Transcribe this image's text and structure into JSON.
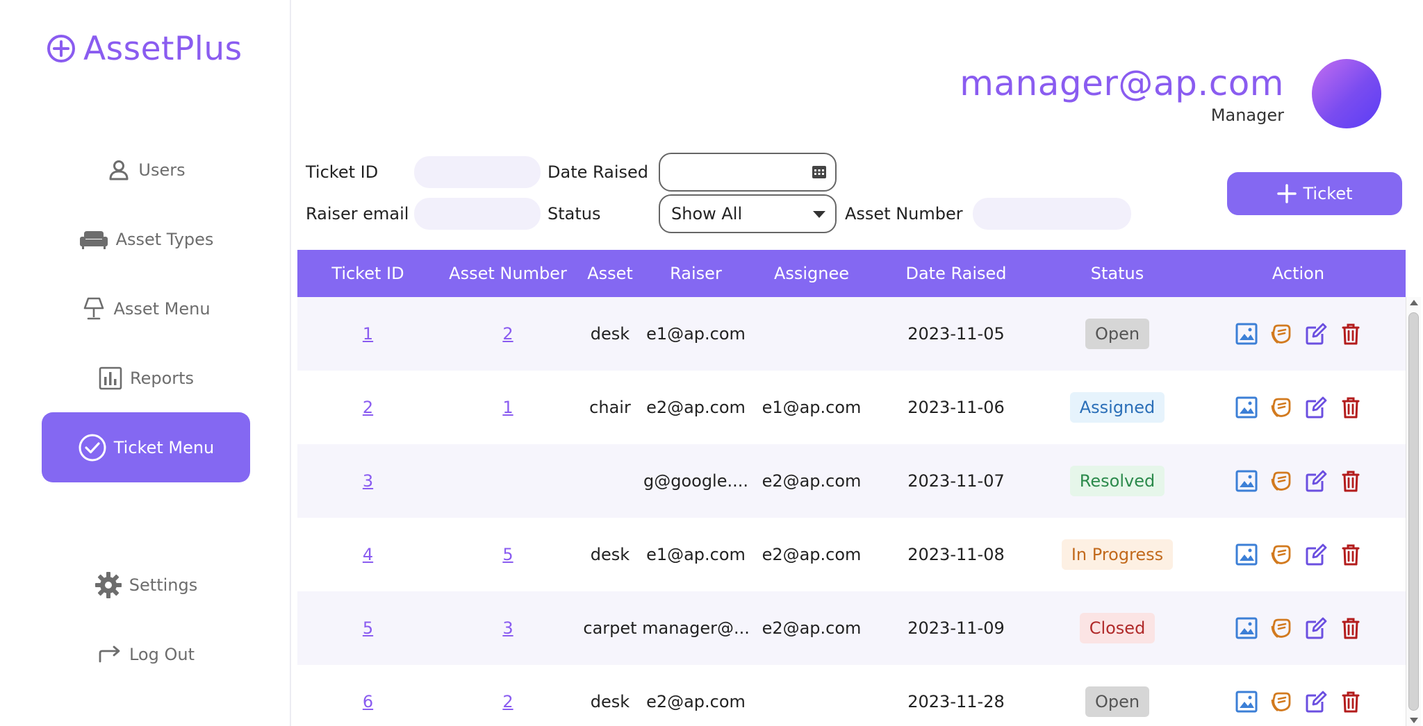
{
  "app": {
    "logo_text": "AssetPlus",
    "accent": "#8468f2"
  },
  "sidebar": {
    "items": [
      {
        "label": "Users",
        "icon": "user-icon"
      },
      {
        "label": "Asset Types",
        "icon": "sofa-icon"
      },
      {
        "label": "Asset Menu",
        "icon": "lamp-icon"
      },
      {
        "label": "Reports",
        "icon": "bar-chart-icon"
      },
      {
        "label": "Ticket Menu",
        "icon": "check-circle-icon",
        "active": true
      },
      {
        "label": "Settings",
        "icon": "gear-icon"
      },
      {
        "label": "Log Out",
        "icon": "logout-arrow-icon"
      }
    ]
  },
  "user": {
    "email": "manager@ap.com",
    "role": "Manager"
  },
  "filters": {
    "ticket_id_label": "Ticket ID",
    "ticket_id_value": "",
    "date_raised_label": "Date Raised",
    "date_raised_value": "",
    "raiser_email_label": "Raiser email",
    "raiser_email_value": "",
    "status_label": "Status",
    "status_value": "Show All",
    "asset_number_label": "Asset Number",
    "asset_number_value": ""
  },
  "add_ticket_label": "Ticket",
  "table": {
    "headers": [
      "Ticket ID",
      "Asset Number",
      "Asset",
      "Raiser",
      "Assignee",
      "Date Raised",
      "Status",
      "Action"
    ],
    "rows": [
      {
        "ticket_id": "1",
        "asset_number": "2",
        "asset": "desk",
        "raiser": "e1@ap.com",
        "assignee": "",
        "date": "2023-11-05",
        "status": "Open",
        "status_color": "#555555",
        "status_bg": "#d6d6d6"
      },
      {
        "ticket_id": "2",
        "asset_number": "1",
        "asset": "chair",
        "raiser": "e2@ap.com",
        "assignee": "e1@ap.com",
        "date": "2023-11-06",
        "status": "Assigned",
        "status_color": "#2b6fb8",
        "status_bg": "#e6f3fc"
      },
      {
        "ticket_id": "3",
        "asset_number": "",
        "asset": "",
        "raiser": "g@google....",
        "assignee": "e2@ap.com",
        "date": "2023-11-07",
        "status": "Resolved",
        "status_color": "#2c8a4c",
        "status_bg": "#e6f6ea"
      },
      {
        "ticket_id": "4",
        "asset_number": "5",
        "asset": "desk",
        "raiser": "e1@ap.com",
        "assignee": "e2@ap.com",
        "date": "2023-11-08",
        "status": "In Progress",
        "status_color": "#c26a1d",
        "status_bg": "#fdf0e3"
      },
      {
        "ticket_id": "5",
        "asset_number": "3",
        "asset": "carpet",
        "raiser": "manager@...",
        "assignee": "e2@ap.com",
        "date": "2023-11-09",
        "status": "Closed",
        "status_color": "#b02a2a",
        "status_bg": "#fbe4e4"
      },
      {
        "ticket_id": "6",
        "asset_number": "2",
        "asset": "desk",
        "raiser": "e2@ap.com",
        "assignee": "",
        "date": "2023-11-28",
        "status": "Open",
        "status_color": "#555555",
        "status_bg": "#d6d6d6"
      }
    ]
  },
  "action_icons": [
    {
      "name": "image-icon",
      "color": "#3c7fd6"
    },
    {
      "name": "rating-icon",
      "color": "#d27a1f"
    },
    {
      "name": "edit-icon",
      "color": "#6b4fe0"
    },
    {
      "name": "delete-icon",
      "color": "#b31c1c"
    }
  ]
}
